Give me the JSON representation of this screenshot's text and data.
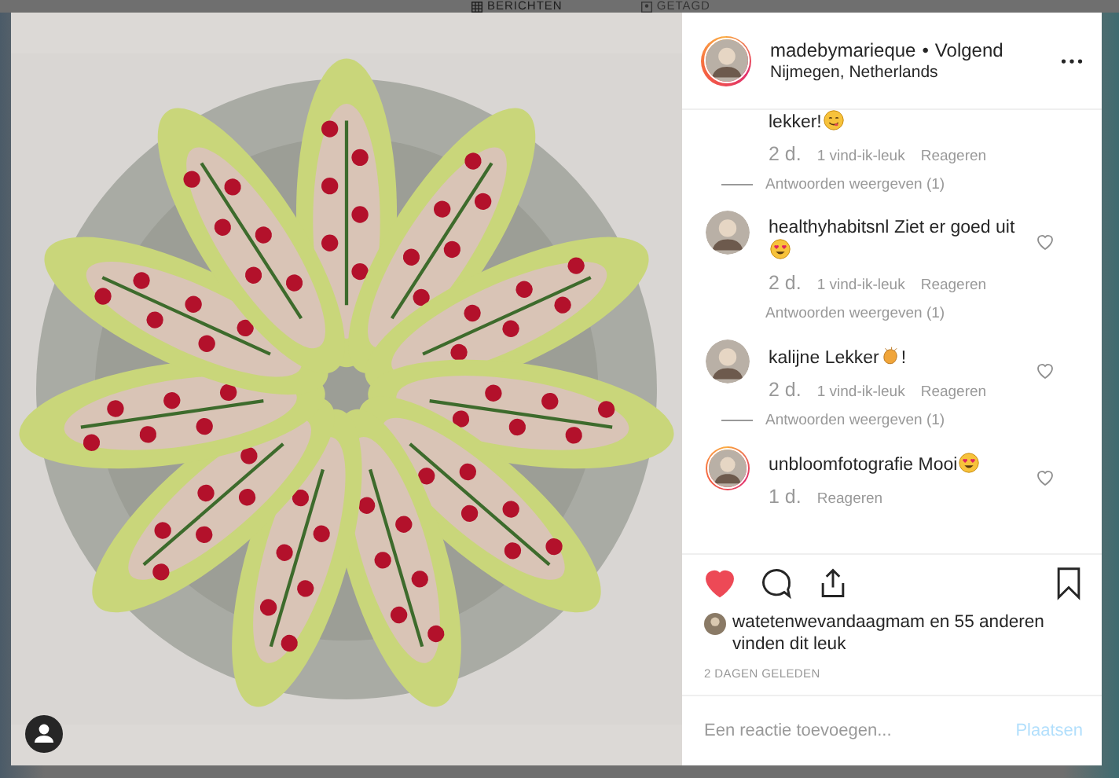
{
  "background_tabs": [
    {
      "label": "BERICHTEN",
      "selected": true
    },
    {
      "label": "GETAGD",
      "selected": false
    }
  ],
  "post": {
    "author": {
      "username": "madebymarieque",
      "separator": "•",
      "follow_status": "Volgend",
      "location": "Nijmegen, Netherlands",
      "story_ring": true
    },
    "comments": [
      {
        "text": "lekker!",
        "emoji": true,
        "time": "2 d.",
        "likes": "1 vind-ik-leuk",
        "reply": "Reageren",
        "view_replies": "Antwoorden weergeven (1)",
        "reply_line": true
      },
      {
        "username": "healthyhabitsnl",
        "text": "Ziet er goed uit",
        "emoji": true,
        "story_ring": false,
        "liked": false,
        "time": "2 d.",
        "likes": "1 vind-ik-leuk",
        "reply": "Reageren",
        "view_replies": "Antwoorden weergeven (1)",
        "reply_line": false
      },
      {
        "username": "kalijne",
        "text": "Lekker",
        "emoji": true,
        "text_after": "!",
        "story_ring": false,
        "liked": false,
        "time": "2 d.",
        "likes": "1 vind-ik-leuk",
        "reply": "Reageren",
        "view_replies": "Antwoorden weergeven (1)",
        "reply_line": true
      },
      {
        "username": "unbloomfotografie",
        "text": "Mooi",
        "emoji": true,
        "story_ring": true,
        "liked": false,
        "time": "1 d.",
        "reply": "Reageren"
      }
    ],
    "liked": true,
    "saved": false,
    "likes_text": "watetenwevandaagmam en 55 anderen vinden dit leuk",
    "posted": "2 DAGEN GELEDEN",
    "comment_input": {
      "placeholder": "Een reactie toevoegen..."
    },
    "post_button": {
      "label": "Plaatsen",
      "disabled": true
    }
  }
}
